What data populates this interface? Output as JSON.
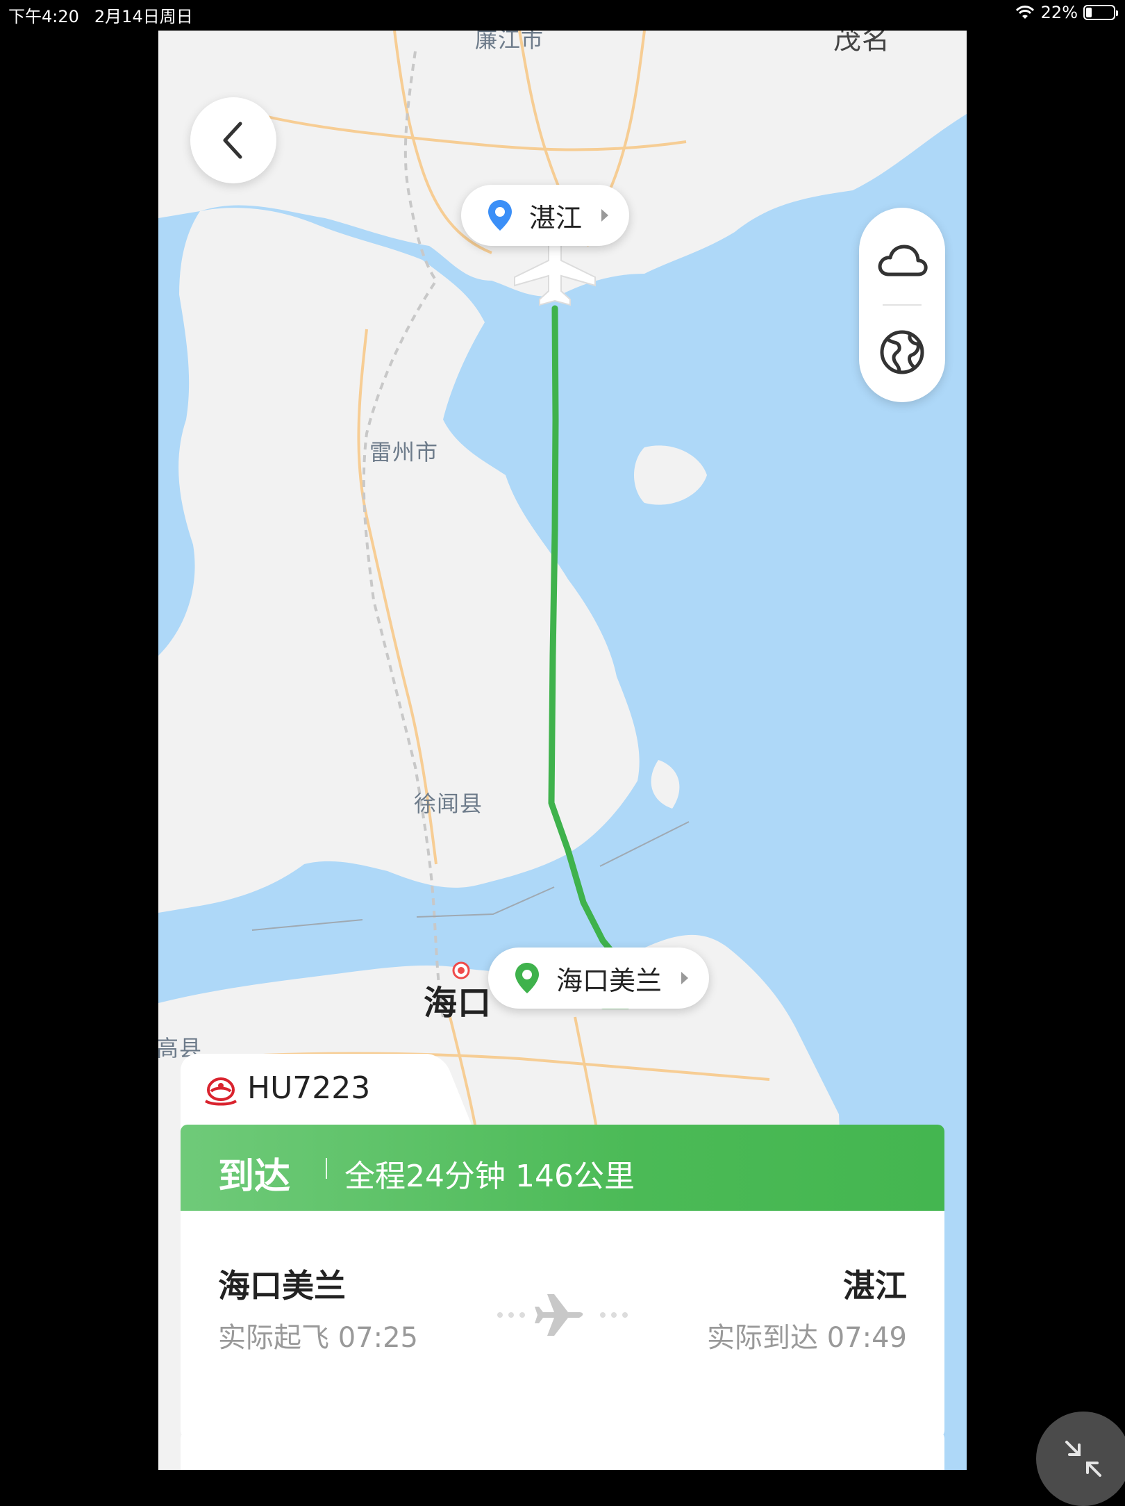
{
  "status_bar": {
    "time": "下午4:20",
    "date": "2月14日周日",
    "battery": "22%",
    "battery_level": 0.22
  },
  "map": {
    "labels": {
      "lianjiang": "廉江市",
      "maoming": "茂名",
      "leizhou": "雷州市",
      "xuwen": "徐闻县",
      "haikou": "海口",
      "lingao": "临高县"
    }
  },
  "pins": {
    "destination": "湛江",
    "origin": "海口美兰"
  },
  "flight": {
    "number": "HU7223",
    "status": "到达",
    "summary": "全程24分钟 146公里",
    "departure": {
      "airport": "海口美兰",
      "label": "实际起飞 07:25"
    },
    "arrival": {
      "airport": "湛江",
      "label": "实际到达 07:49"
    }
  },
  "colors": {
    "route": "#3fb24c",
    "status_green": "#4bba56",
    "water": "#aed8f8",
    "land": "#f2f2f2"
  },
  "icons": {
    "back": "chevron-left-icon",
    "weather": "cloud-icon",
    "globe": "globe-icon",
    "pin_destination": "location-pin-blue-icon",
    "pin_origin": "location-pin-green-icon",
    "airline": "hainan-airlines-logo-icon",
    "plane": "airplane-icon",
    "collapse": "collapse-arrows-icon"
  }
}
